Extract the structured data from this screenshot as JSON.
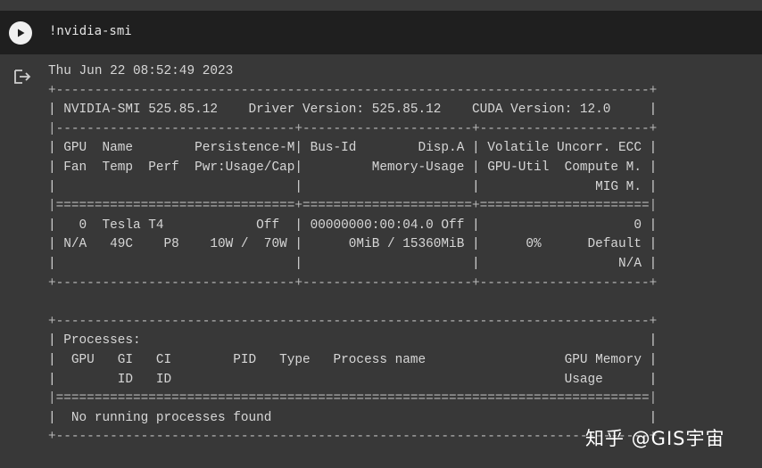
{
  "cell": {
    "run_button_icon": "play-icon",
    "code": "!nvidia-smi"
  },
  "output": {
    "icon": "output-redirect-icon",
    "lines": [
      "Thu Jun 22 08:52:49 2023",
      "+-----------------------------------------------------------------------------+",
      "| NVIDIA-SMI 525.85.12    Driver Version: 525.85.12    CUDA Version: 12.0     |",
      "|-------------------------------+----------------------+----------------------+",
      "| GPU  Name        Persistence-M| Bus-Id        Disp.A | Volatile Uncorr. ECC |",
      "| Fan  Temp  Perf  Pwr:Usage/Cap|         Memory-Usage | GPU-Util  Compute M. |",
      "|                               |                      |               MIG M. |",
      "|===============================+======================+======================|",
      "|   0  Tesla T4            Off  | 00000000:00:04.0 Off |                    0 |",
      "| N/A   49C    P8    10W /  70W |      0MiB / 15360MiB |      0%      Default |",
      "|                               |                      |                  N/A |",
      "+-------------------------------+----------------------+----------------------+",
      "",
      "+-----------------------------------------------------------------------------+",
      "| Processes:                                                                  |",
      "|  GPU   GI   CI        PID   Type   Process name                  GPU Memory |",
      "|        ID   ID                                                   Usage      |",
      "|=============================================================================|",
      "|  No running processes found                                                 |",
      "+-----------------------------------------------------------------------------+"
    ]
  },
  "watermark": "知乎 @GIS宇宙"
}
